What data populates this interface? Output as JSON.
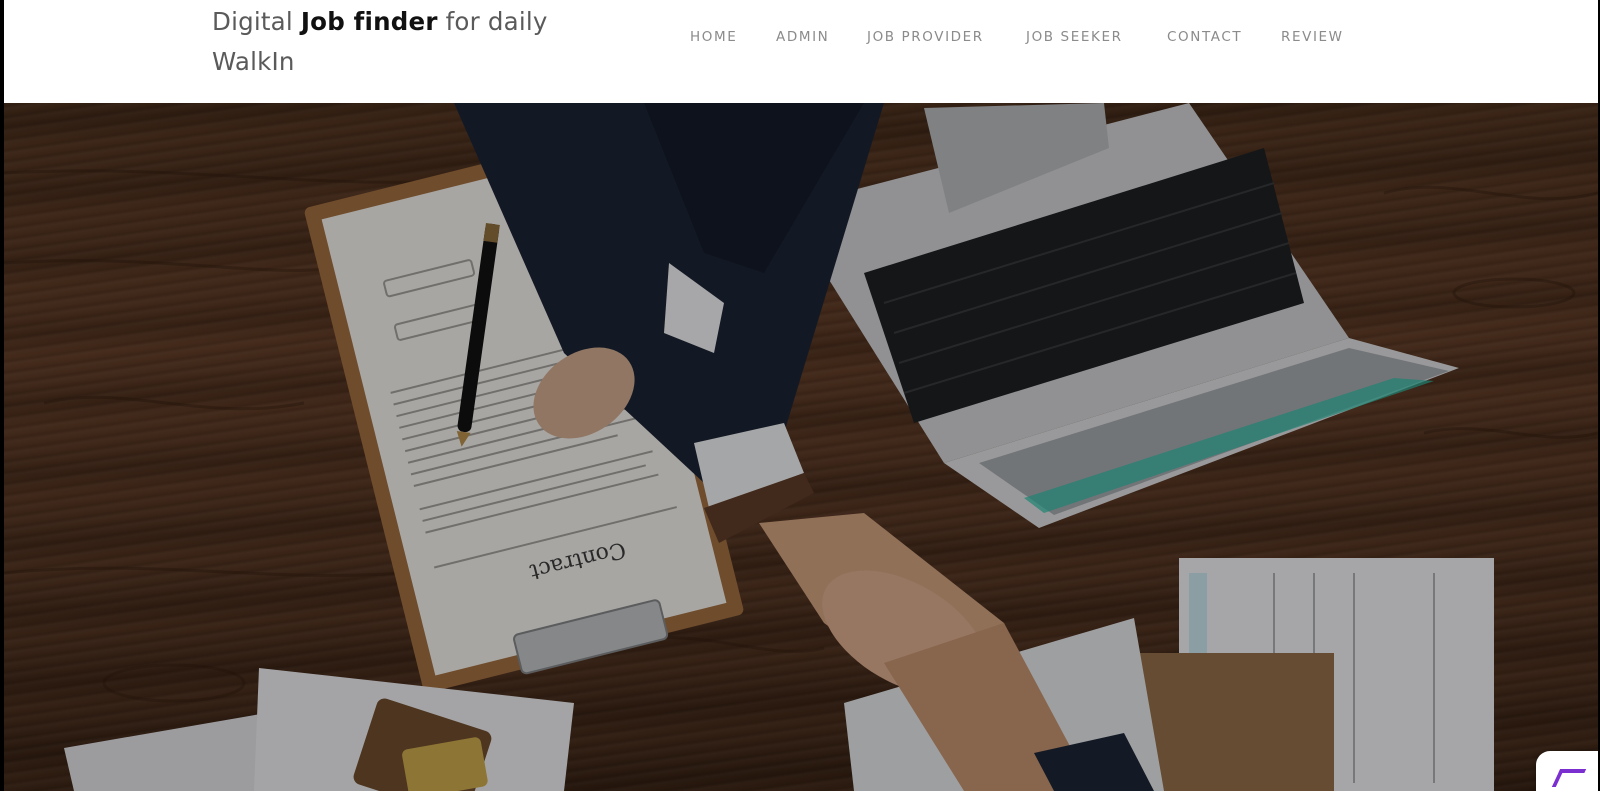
{
  "header": {
    "brand": {
      "prefix": "Digital ",
      "bold": "Job finder",
      "suffix_line1": " for daily",
      "line2": "WalkIn"
    },
    "nav": [
      {
        "label": "HOME"
      },
      {
        "label": "ADMIN"
      },
      {
        "label": "JOB PROVIDER"
      },
      {
        "label": "JOB SEEKER"
      },
      {
        "label": "CONTACT"
      },
      {
        "label": "REVIEW"
      }
    ]
  },
  "hero": {
    "contract_text": "Contract",
    "colors": {
      "wood": "#5a3824",
      "sleeve_dark": "#1b2333",
      "laptop": "#cfd0d2",
      "accent_teal": "#2bb5a0"
    }
  },
  "widget": {
    "icon": "recaptcha-style-icon"
  }
}
